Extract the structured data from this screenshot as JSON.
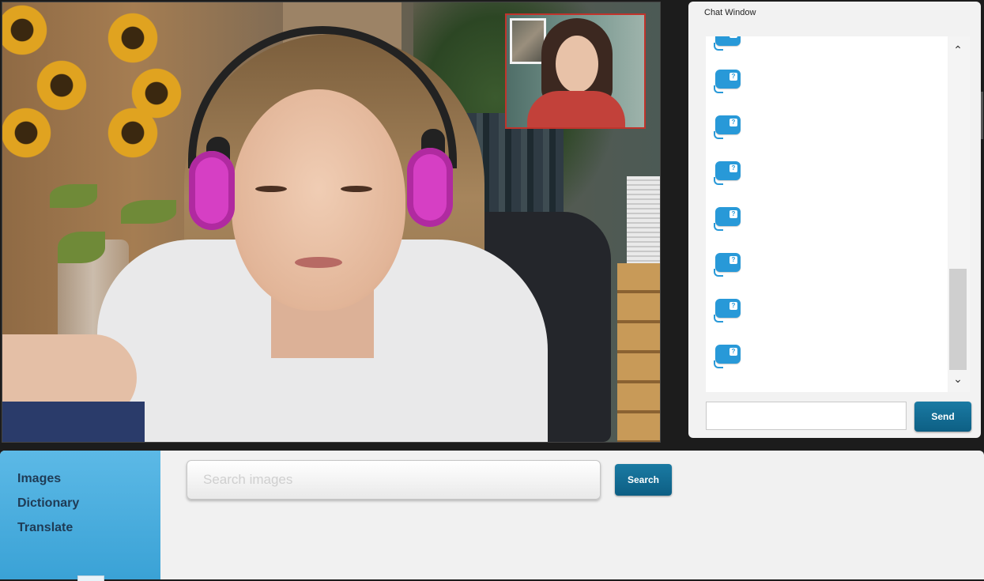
{
  "video": {
    "main_feed": "remote-participant-video",
    "self_view": "local-participant-video"
  },
  "chat": {
    "title": "Chat Window",
    "message_count_visible": 8,
    "bubble_icon": "chat-bubble-icon",
    "bubble_glyph": "?",
    "scroll_up": "⌃",
    "scroll_down": "⌄",
    "input_value": "",
    "send_label": "Send"
  },
  "tools": {
    "items": [
      "Images",
      "Dictionary",
      "Translate"
    ],
    "search_placeholder": "Search images",
    "search_label": "Search"
  },
  "colors": {
    "accent": "#0d5f84",
    "sidebar": "#3aa2d6",
    "bubble": "#2899d8",
    "pip_border": "#c0342c"
  }
}
